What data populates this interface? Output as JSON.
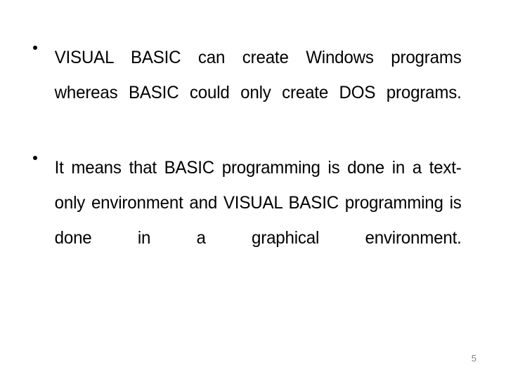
{
  "slide": {
    "page_number": "5",
    "background_color": "#ffffff",
    "text_color": "#000000",
    "page_number_color": "#808080",
    "bullets": [
      {
        "marker": "•",
        "text": "VISUAL BASIC can create Windows programs whereas BASIC could only create DOS programs."
      },
      {
        "marker": "•",
        "text": "It means that BASIC programming is done in a text-only environment and VISUAL BASIC programming is done in a graphical environment."
      }
    ]
  }
}
